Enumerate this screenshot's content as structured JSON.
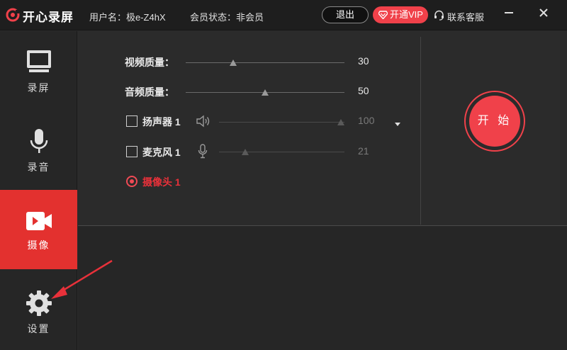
{
  "titlebar": {
    "app_title": "开心录屏",
    "user_label": "用户名：极e-Z4hX",
    "member_label": "会员状态：非会员",
    "logout": "退出",
    "vip": "开通VIP",
    "support": "联系客服"
  },
  "sidebar": {
    "items": [
      {
        "label": "录屏",
        "icon": "monitor-icon"
      },
      {
        "label": "录音",
        "icon": "microphone-icon"
      },
      {
        "label": "摄像",
        "icon": "camera-icon"
      },
      {
        "label": "设置",
        "icon": "gear-icon"
      }
    ],
    "active_index": 2
  },
  "controls": {
    "video_quality": {
      "label": "视频质量：",
      "value": "30",
      "level": 0.3
    },
    "audio_quality": {
      "label": "音频质量：",
      "value": "50",
      "level": 0.5
    },
    "speaker": {
      "label": "扬声器 1",
      "value": "100",
      "checked": false,
      "level": 1.0
    },
    "microphone": {
      "label": "麦克风 1",
      "value": "21",
      "checked": false,
      "level": 0.21
    },
    "camera": {
      "label": "摄像头 1",
      "selected": true
    }
  },
  "start_button": "开 始",
  "colors": {
    "accent": "#f0414a",
    "active_nav": "#e3312f",
    "background": "#2b2b2b"
  }
}
